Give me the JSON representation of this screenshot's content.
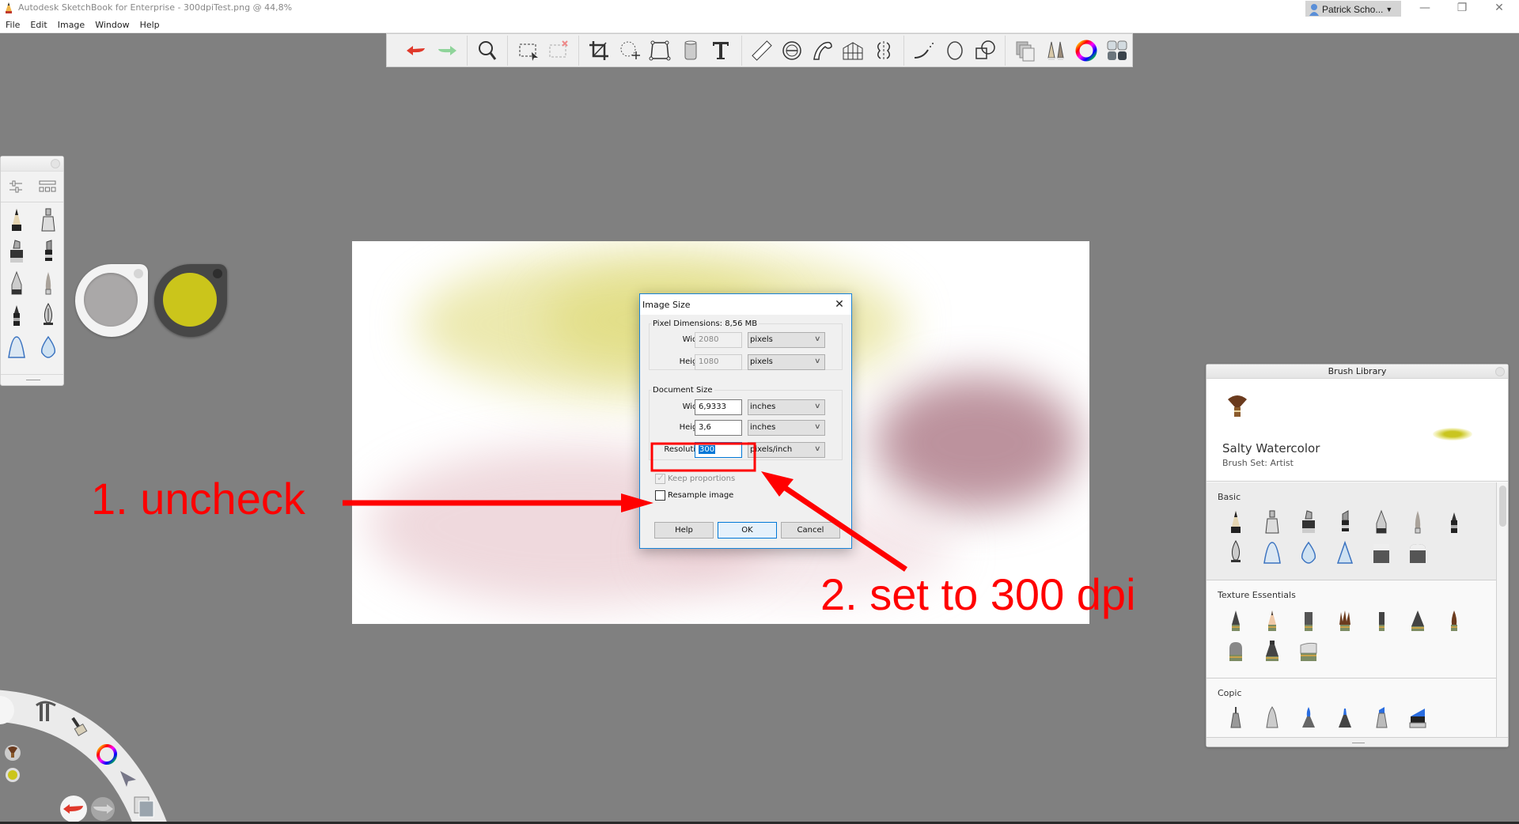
{
  "window": {
    "title": "Autodesk SketchBook for Enterprise - 300dpiTest.png @ 44,8%",
    "user": "Patrick Scho...",
    "controls": [
      "minimize",
      "restore",
      "close"
    ]
  },
  "menu": [
    "File",
    "Edit",
    "Image",
    "Window",
    "Help"
  ],
  "toolbar": {
    "groups": [
      [
        "undo-icon",
        "redo-icon"
      ],
      [
        "zoom-icon"
      ],
      [
        "select-icon",
        "clear-selection-icon"
      ],
      [
        "crop-icon",
        "transform-icon",
        "distort-icon",
        "perspective-icon",
        "text-icon"
      ],
      [
        "ruler-icon",
        "ellipse-guide-icon",
        "french-curve-icon",
        "perspective-guide-icon",
        "symmetry-icon"
      ],
      [
        "steady-stroke-icon",
        "ellipse-tool-icon",
        "shape-icon"
      ],
      [
        "layers-icon",
        "brushes-icon",
        "color-wheel-icon",
        "copic-library-icon"
      ]
    ]
  },
  "dialog": {
    "title": "Image Size",
    "pixel_dimensions": {
      "legend": "Pixel Dimensions: 8,56 MB",
      "width_label": "Width:",
      "width_value": "2080",
      "width_unit": "pixels",
      "height_label": "Height:",
      "height_value": "1080",
      "height_unit": "pixels"
    },
    "document_size": {
      "legend": "Document Size",
      "width_label": "Width:",
      "width_value": "6,9333",
      "width_unit": "inches",
      "height_label": "Height:",
      "height_value": "3,6",
      "height_unit": "inches",
      "resolution_label": "Resolution:",
      "resolution_value": "300",
      "resolution_unit": "pixels/inch"
    },
    "keep_proportions": {
      "label": "Keep proportions",
      "checked": true,
      "disabled": true
    },
    "resample_image": {
      "label": "Resample image",
      "checked": false
    },
    "buttons": {
      "help": "Help",
      "ok": "OK",
      "cancel": "Cancel"
    }
  },
  "annotations": {
    "step1": "1. uncheck",
    "step2": "2. set to 300 dpi",
    "color": "#ff0000"
  },
  "colors": {
    "background_puck": "#aaa8a8",
    "foreground_puck": "#cbc51b"
  },
  "brush_library": {
    "title": "Brush Library",
    "current_brush": "Salty Watercolor",
    "current_set": "Brush Set: Artist",
    "sections": [
      {
        "title": "Basic",
        "brushes": [
          "pencil",
          "inking-pen",
          "marker",
          "chisel-marker",
          "ballpoint",
          "paintbrush",
          "felt-pen",
          "fountain-pen",
          "airbrush",
          "water-drop",
          "triangle-airbrush",
          "hard-eraser",
          "soft-eraser"
        ]
      },
      {
        "title": "Texture Essentials",
        "brushes": [
          "texture-pencil",
          "texture-sketch",
          "texture-block",
          "texture-bristle",
          "texture-marker",
          "texture-cone",
          "texture-brush",
          "texture-round",
          "texture-nozzle",
          "texture-wide"
        ]
      },
      {
        "title": "Copic",
        "brushes": [
          "copic-fine",
          "copic-bullet",
          "copic-brush",
          "copic-round",
          "copic-chisel",
          "copic-wide"
        ]
      }
    ]
  }
}
